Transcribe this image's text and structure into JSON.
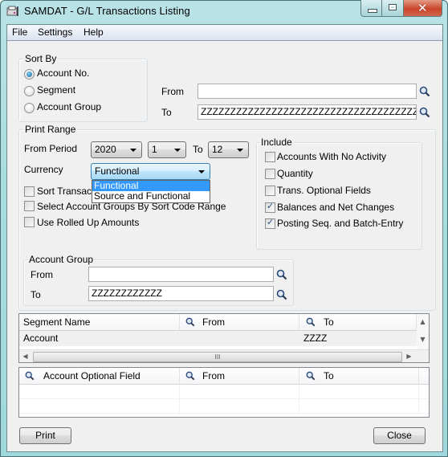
{
  "window": {
    "title": "SAMDAT - G/L Transactions Listing",
    "controls": {
      "minimize": "minimize",
      "maximize": "maximize",
      "close": "close"
    }
  },
  "menu": [
    "File",
    "Settings",
    "Help"
  ],
  "sort_by": {
    "label": "Sort By",
    "options": [
      {
        "label": "Account No.",
        "selected": true
      },
      {
        "label": "Segment",
        "selected": false
      },
      {
        "label": "Account Group",
        "selected": false
      }
    ]
  },
  "account_range": {
    "from_label": "From",
    "from_value": "",
    "to_label": "To",
    "to_value": "ZZZZZZZZZZZZZZZZZZZZZZZZZZZZZZZZZZZZZZZZZZZZ"
  },
  "print_range": {
    "label": "Print Range",
    "from_period_label": "From Period",
    "year": "2020",
    "from_period": "1",
    "to_label": "To",
    "to_period": "12",
    "currency_label": "Currency",
    "currency_value": "Functional",
    "currency_options": [
      {
        "label": "Functional",
        "selected": true
      },
      {
        "label": "Source and Functional",
        "selected": false
      }
    ],
    "checkboxes": [
      {
        "label": "Sort Transactions by Transaction Date",
        "checked": false
      },
      {
        "label": "Select Account Groups By Sort Code Range",
        "checked": false
      },
      {
        "label": "Use Rolled Up Amounts",
        "checked": false
      }
    ]
  },
  "include": {
    "label": "Include",
    "items": [
      {
        "label": "Accounts With No Activity",
        "checked": false
      },
      {
        "label": "Quantity",
        "checked": false
      },
      {
        "label": "Trans. Optional Fields",
        "checked": false
      },
      {
        "label": "Balances and Net Changes",
        "checked": true
      },
      {
        "label": "Posting Seq. and Batch-Entry",
        "checked": true
      }
    ]
  },
  "account_group": {
    "label": "Account Group",
    "from_label": "From",
    "from_value": "",
    "to_label": "To",
    "to_value": "ZZZZZZZZZZZZ"
  },
  "segment_grid": {
    "columns": [
      "Segment Name",
      "From",
      "To"
    ],
    "rows": [
      {
        "segment_name": "Account",
        "from": "",
        "to": "ZZZZ"
      }
    ],
    "hscroll_grip": "III"
  },
  "optional_field_grid": {
    "columns": [
      "Account Optional Field",
      "From",
      "To"
    ],
    "rows": []
  },
  "buttons": {
    "print": "Print",
    "close": "Close"
  },
  "colors": {
    "selection": "#3399ff",
    "titlebar": "#a8dde0",
    "close_button": "#c9452b"
  }
}
